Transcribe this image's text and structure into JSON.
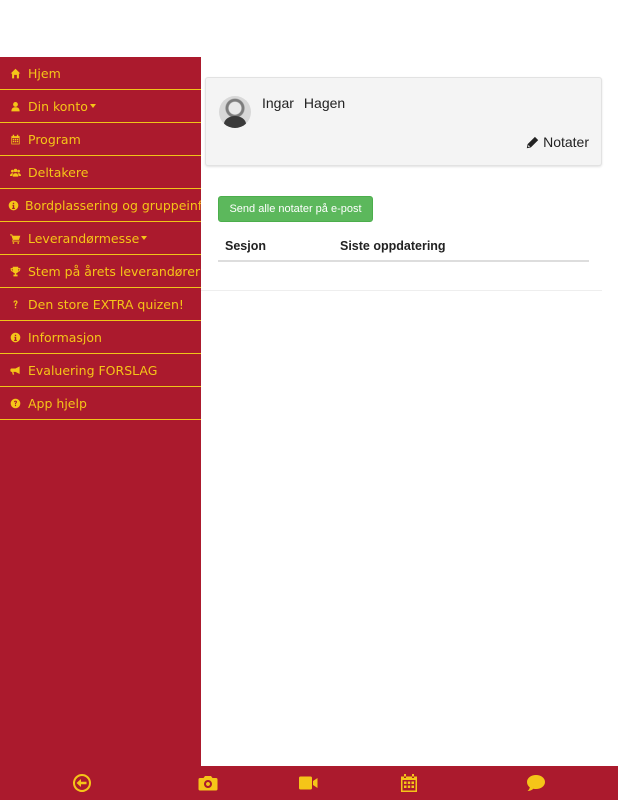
{
  "colors": {
    "accent_red": "#ab1a2d",
    "accent_yellow": "#f5c518",
    "button_green": "#5cb85c"
  },
  "sidebar": {
    "items": [
      {
        "label": "Hjem",
        "icon": "home-icon"
      },
      {
        "label": "Din konto",
        "icon": "user-icon",
        "dropdown": true
      },
      {
        "label": "Program",
        "icon": "calendar-icon"
      },
      {
        "label": "Deltakere",
        "icon": "users-icon"
      },
      {
        "label": "Bordplassering og gruppeinfo",
        "icon": "info-circle-icon"
      },
      {
        "label": "Leverandørmesse",
        "icon": "cart-icon",
        "dropdown": true
      },
      {
        "label": "Stem på årets leverandører",
        "icon": "trophy-icon"
      },
      {
        "label": "Den store EXTRA quizen!",
        "icon": "question-icon"
      },
      {
        "label": "Informasjon",
        "icon": "info-circle-icon"
      },
      {
        "label": "Evaluering FORSLAG",
        "icon": "bullhorn-icon"
      },
      {
        "label": "App hjelp",
        "icon": "question-circle-icon"
      }
    ]
  },
  "profile": {
    "first_name": "Ingar",
    "last_name": "Hagen",
    "notes_link": "Notater"
  },
  "main": {
    "send_button": "Send alle notater på e-post",
    "table": {
      "columns": [
        "Sesjon",
        "Siste oppdatering"
      ]
    }
  },
  "bottom_nav": {
    "tabs": [
      {
        "icon": "back-circle-icon"
      },
      {
        "icon": "camera-icon"
      },
      {
        "icon": "video-camera-icon"
      },
      {
        "icon": "calendar-icon"
      },
      {
        "icon": "chat-bubble-icon"
      }
    ]
  }
}
